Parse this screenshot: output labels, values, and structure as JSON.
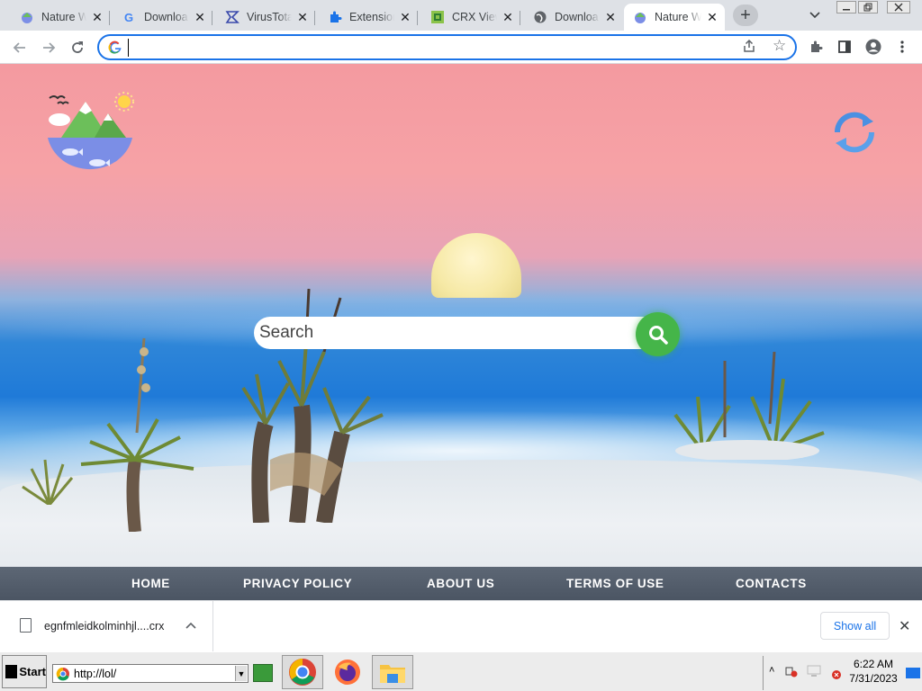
{
  "browser": {
    "tabs": [
      {
        "title": "Nature W",
        "favicon": "nature-favicon",
        "active": false
      },
      {
        "title": "Downloa",
        "favicon": "google-favicon",
        "active": false
      },
      {
        "title": "VirusTota",
        "favicon": "virustotal-favicon",
        "active": false
      },
      {
        "title": "Extension",
        "favicon": "puzzle-favicon",
        "active": false
      },
      {
        "title": "CRX View",
        "favicon": "crx-favicon",
        "active": false
      },
      {
        "title": "Downloa",
        "favicon": "globe-favicon",
        "active": false
      },
      {
        "title": "Nature W",
        "favicon": "nature-favicon",
        "active": true
      }
    ],
    "omnibox": {
      "value": "",
      "placeholder": ""
    }
  },
  "page": {
    "search": {
      "placeholder": "Search"
    },
    "footer_links": [
      "HOME",
      "PRIVACY POLICY",
      "ABOUT US",
      "TERMS OF USE",
      "CONTACTS"
    ],
    "colors": {
      "accent_green": "#45b549",
      "footer": "#4b5563",
      "sky_top": "#f49aa0",
      "water": "#1f7ad8"
    }
  },
  "downloads": {
    "file_name": "egnfmleidkolminhjl....crx",
    "show_all_label": "Show all"
  },
  "taskbar": {
    "start_label": "Start",
    "address_value": "http://lol/",
    "clock_time": "6:22 AM",
    "clock_date": "7/31/2023"
  }
}
